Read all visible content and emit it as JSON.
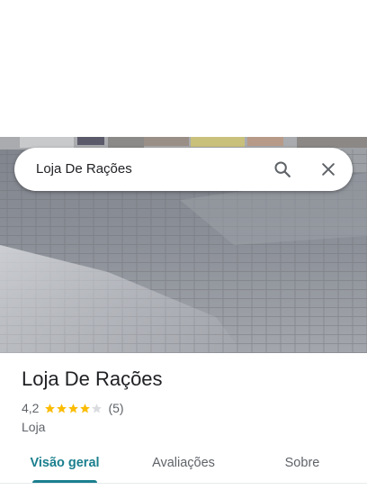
{
  "search": {
    "query": "Loja De Rações",
    "search_icon": "search-icon",
    "close_icon": "close-icon"
  },
  "place": {
    "name": "Loja De Rações",
    "rating": "4,2",
    "rating_value": 4.2,
    "stars_total": 5,
    "review_count": "(5)",
    "category": "Loja"
  },
  "tabs": [
    {
      "label": "Visão geral",
      "active": true
    },
    {
      "label": "Avaliações",
      "active": false
    },
    {
      "label": "Sobre",
      "active": false
    }
  ],
  "colors": {
    "star": "#fbbc04",
    "star_empty": "#dadce0",
    "active_tab": "#1a7f8e"
  }
}
